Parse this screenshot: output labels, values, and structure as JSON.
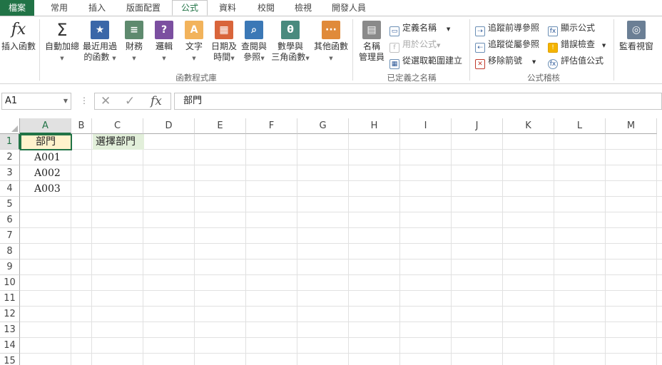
{
  "tabs": [
    "檔案",
    "常用",
    "插入",
    "版面配置",
    "公式",
    "資料",
    "校閱",
    "檢視",
    "開發人員"
  ],
  "ribbon": {
    "insert_function": "插入函數",
    "autosum": "自動加總",
    "recent_1": "最近用過",
    "recent_2": "的函數",
    "financial": "財務",
    "logical": "邏輯",
    "text": "文字",
    "datetime_1": "日期及",
    "datetime_2": "時間",
    "lookup_1": "查閱與",
    "lookup_2": "參照",
    "math_1": "數學與",
    "math_2": "三角函數",
    "more": "其他函數",
    "library_group": "函數程式庫",
    "name_manager_1": "名稱",
    "name_manager_2": "管理員",
    "define_name": "定義名稱",
    "use_in_formula": "用於公式",
    "create_from_selection": "從選取範圍建立",
    "defined_names_group": "已定義之名稱",
    "trace_precedents": "追蹤前導參照",
    "trace_dependents": "追蹤從屬參照",
    "remove_arrows": "移除箭號",
    "show_formulas": "顯示公式",
    "error_checking": "錯誤檢查",
    "evaluate_formula": "評估值公式",
    "auditing_group": "公式稽核",
    "watch_window": "監看視窗"
  },
  "formula_bar": {
    "name_box": "A1",
    "fx": "fx",
    "content": "部門"
  },
  "columns": [
    "A",
    "B",
    "C",
    "D",
    "E",
    "F",
    "G",
    "H",
    "I",
    "J",
    "K",
    "L",
    "M"
  ],
  "rows": [
    "1",
    "2",
    "3",
    "4",
    "5",
    "6",
    "7",
    "8",
    "9",
    "10",
    "11",
    "12",
    "13",
    "14",
    "15"
  ],
  "cells": {
    "A1": "部門",
    "C1": "選擇部門",
    "A2": "A001",
    "A3": "A002",
    "A4": "A003"
  },
  "colors": {
    "accent": "#217346",
    "a1_fill": "#fff2cc",
    "c1_fill": "#e2efda"
  }
}
